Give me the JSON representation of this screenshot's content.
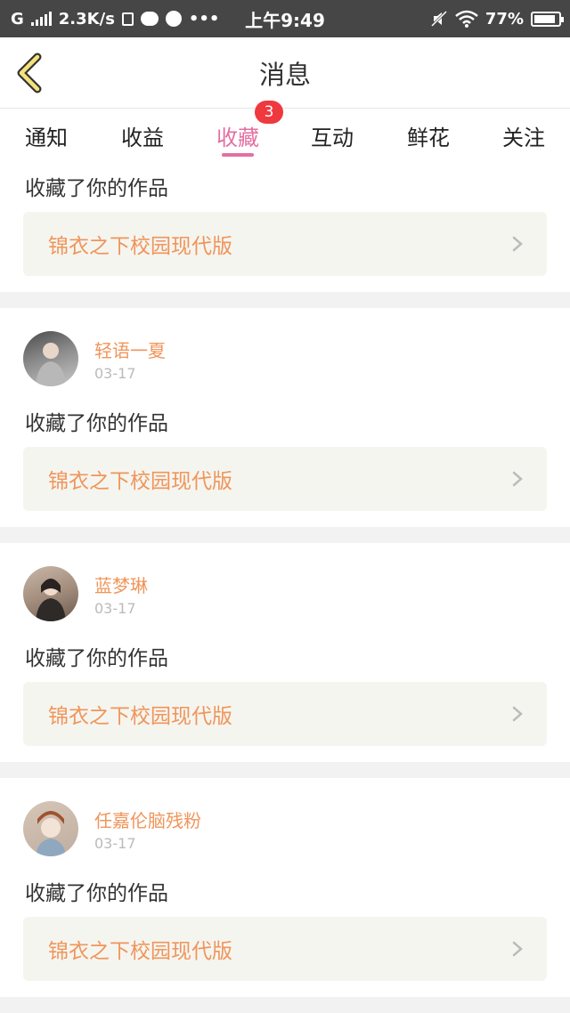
{
  "status": {
    "carrier": "G",
    "speed": "2.3K/s",
    "time": "上午9:49",
    "battery": "77%",
    "dots": "•••"
  },
  "header": {
    "title": "消息"
  },
  "tabs": [
    {
      "label": "通知"
    },
    {
      "label": "收益"
    },
    {
      "label": "收藏"
    },
    {
      "label": "互动"
    },
    {
      "label": "鲜花"
    },
    {
      "label": "关注"
    }
  ],
  "badge": "3",
  "first_card": {
    "message": "收藏了你的作品",
    "work": "锦衣之下校园现代版"
  },
  "cards": [
    {
      "name": "轻语一夏",
      "date": "03-17",
      "message": "收藏了你的作品",
      "work": "锦衣之下校园现代版"
    },
    {
      "name": "蓝梦琳",
      "date": "03-17",
      "message": "收藏了你的作品",
      "work": "锦衣之下校园现代版"
    },
    {
      "name": "任嘉伦脑残粉",
      "date": "03-17",
      "message": "收藏了你的作品",
      "work": "锦衣之下校园现代版"
    }
  ],
  "colors": {
    "accent": "#e36fa0",
    "name": "#f0955a",
    "badge": "#f0383f"
  },
  "icons": [
    "back-chevron-icon",
    "signal-icon",
    "sd-icon",
    "cat-icon",
    "globe-icon",
    "mute-icon",
    "wifi-icon",
    "battery-icon",
    "chevron-right-icon"
  ]
}
